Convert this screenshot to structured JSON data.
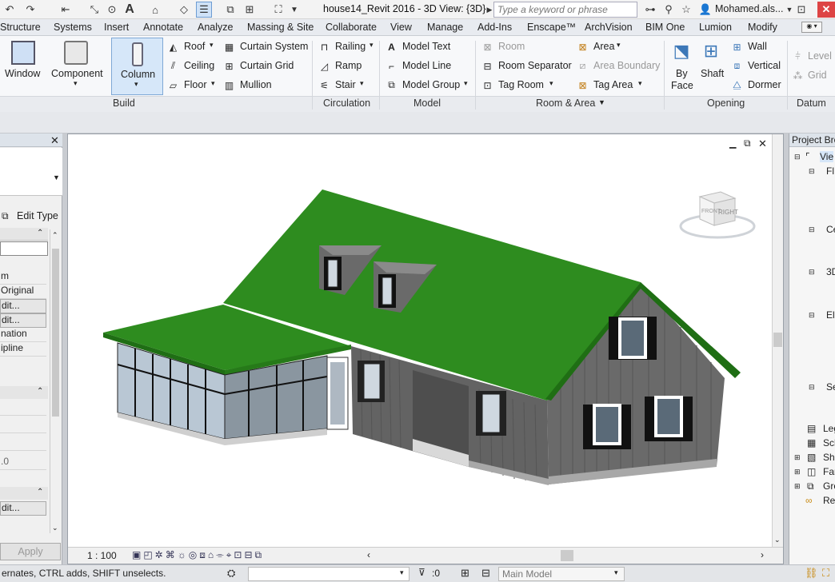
{
  "titlebar": {
    "document_title": "house14_Revit 2016 - 3D View: {3D}",
    "search_placeholder": "Type a keyword or phrase",
    "user": "Mohamed.als..."
  },
  "tabs": [
    "Structure",
    "Systems",
    "Insert",
    "Annotate",
    "Analyze",
    "Massing & Site",
    "Collaborate",
    "View",
    "Manage",
    "Add-Ins",
    "Enscape™",
    "ArchVision",
    "BIM One",
    "Lumion",
    "Modify"
  ],
  "ribbon": {
    "build": {
      "title": "Build",
      "window": "Window",
      "component": "Component",
      "column": "Column",
      "roof": "Roof",
      "ceiling": "Ceiling",
      "floor": "Floor",
      "curtain_system": "Curtain System",
      "curtain_grid": "Curtain Grid",
      "mullion": "Mullion"
    },
    "circulation": {
      "title": "Circulation",
      "railing": "Railing",
      "ramp": "Ramp",
      "stair": "Stair"
    },
    "model": {
      "title": "Model",
      "model_text": "Model Text",
      "model_line": "Model Line",
      "model_group": "Model Group"
    },
    "room_area": {
      "title": "Room & Area",
      "room": "Room",
      "room_separator": "Room Separator",
      "tag_room": "Tag Room",
      "area": "Area",
      "area_boundary": "Area Boundary",
      "tag_area": "Tag Area"
    },
    "opening": {
      "title": "Opening",
      "by_face_1": "By",
      "by_face_2": "Face",
      "shaft": "Shaft",
      "wall": "Wall",
      "vertical": "Vertical",
      "dormer": "Dormer"
    },
    "datum": {
      "title": "Datum",
      "level": "Level",
      "grid": "Grid"
    }
  },
  "properties": {
    "edit_type": "Edit Type",
    "rows": [
      "",
      "m",
      "Original",
      "dit...",
      "dit...",
      "nation",
      "ipline",
      "",
      "",
      "",
      "",
      ".0",
      "",
      "dit..."
    ],
    "apply": "Apply"
  },
  "viewport": {
    "scale": "1 : 100",
    "viewcube_front": "FRONT",
    "viewcube_right": "RIGHT"
  },
  "browser": {
    "title": "Project Bro",
    "items": [
      "Vie",
      "Fl",
      "Ce",
      "3D",
      "El",
      "Se",
      "Leg",
      "Sch",
      "She",
      "Fan",
      "Gro",
      "Re"
    ]
  },
  "statusbar": {
    "message": "ernates, CTRL adds, SHIFT unselects.",
    "selection_count": ":0",
    "model": "Main Model"
  },
  "colors": {
    "roof": "#2e8c1f",
    "roof_dark": "#1f6e14",
    "siding": "#6d6d6d",
    "ribbon_bg": "#f7f8fa"
  }
}
